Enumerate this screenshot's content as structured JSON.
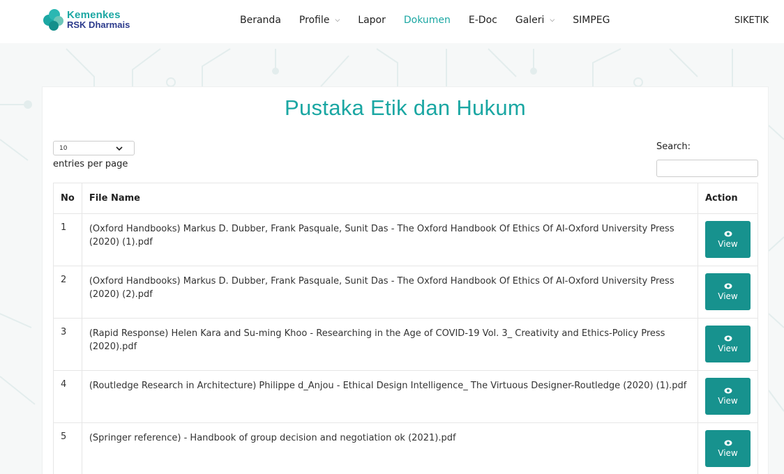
{
  "logo": {
    "line1": "Kemenkes",
    "line2": "RSK Dharmais"
  },
  "nav": {
    "items": [
      {
        "label": "Beranda",
        "dropdown": false,
        "active": false
      },
      {
        "label": "Profile",
        "dropdown": true,
        "active": false
      },
      {
        "label": "Lapor",
        "dropdown": false,
        "active": false
      },
      {
        "label": "Dokumen",
        "dropdown": false,
        "active": true
      },
      {
        "label": "E-Doc",
        "dropdown": false,
        "active": false
      },
      {
        "label": "Galeri",
        "dropdown": true,
        "active": false
      },
      {
        "label": "SIMPEG",
        "dropdown": false,
        "active": false
      }
    ],
    "right_label": "SIKETIK"
  },
  "page": {
    "title": "Pustaka Etik dan Hukum",
    "entries_value": "10",
    "entries_label": "entries per page",
    "search_label": "Search:",
    "search_value": ""
  },
  "table": {
    "headers": {
      "no": "No",
      "file_name": "File Name",
      "action": "Action"
    },
    "view_label": "View",
    "rows": [
      {
        "no": "1",
        "file_name": "(Oxford Handbooks) Markus D. Dubber, Frank Pasquale, Sunit Das - The Oxford Handbook Of Ethics Of AI-Oxford University Press (2020) (1).pdf"
      },
      {
        "no": "2",
        "file_name": "(Oxford Handbooks) Markus D. Dubber, Frank Pasquale, Sunit Das - The Oxford Handbook Of Ethics Of AI-Oxford University Press (2020) (2).pdf"
      },
      {
        "no": "3",
        "file_name": "(Rapid Response) Helen Kara and Su-ming Khoo - Researching in the Age of COVID-19 Vol. 3_ Creativity and Ethics-Policy Press (2020).pdf"
      },
      {
        "no": "4",
        "file_name": "(Routledge Research in Architecture) Philippe d_Anjou - Ethical Design Intelligence_ The Virtuous Designer-Routledge (2020) (1).pdf"
      },
      {
        "no": "5",
        "file_name": "(Springer reference) - Handbook of group decision and negotiation ok (2021).pdf"
      }
    ]
  },
  "colors": {
    "accent": "#1ba7a3",
    "button": "#17928e",
    "logo_blue": "#2b3a8c"
  }
}
